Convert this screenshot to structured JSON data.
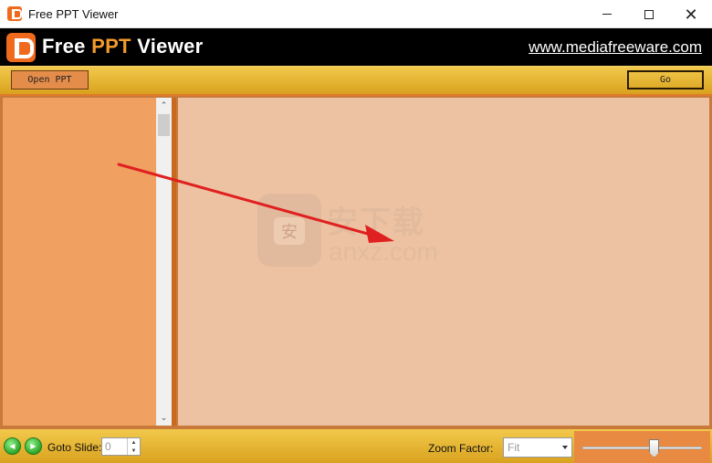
{
  "window": {
    "title": "Free PPT Viewer",
    "controls": {
      "minimize": "minimize",
      "maximize": "maximize",
      "close": "✕"
    }
  },
  "banner": {
    "logo_word1": "Free ",
    "logo_word2": "PPT",
    "logo_word3": " Viewer",
    "website": "www.mediafreeware.com"
  },
  "toolbar": {
    "open_label": "Open PPT",
    "go_label": "Go"
  },
  "sidebar": {
    "scroll_up": "⌃",
    "scroll_down": "⌄"
  },
  "watermark": {
    "chinese": "安下载",
    "latin": "anxz.com",
    "shield_glyph": "安"
  },
  "statusbar": {
    "prev_glyph": "◀",
    "next_glyph": "▶",
    "goto_label": "Goto Slide:",
    "goto_value": "0",
    "zoom_label": "Zoom Factor:",
    "zoom_value": "Fit",
    "zoom_level": 0.6
  },
  "colors": {
    "brand_orange": "#f06a1d",
    "accent_orange": "#f39a2a",
    "toolbar_gold": "#d9a21e",
    "thumb_panel": "#f0a060",
    "slide_bg": "#ecc2a2",
    "annotation_red": "#e02020"
  },
  "icons": {
    "app": "ppt-logo-icon",
    "prev": "arrow-left-icon",
    "next": "arrow-right-icon"
  }
}
